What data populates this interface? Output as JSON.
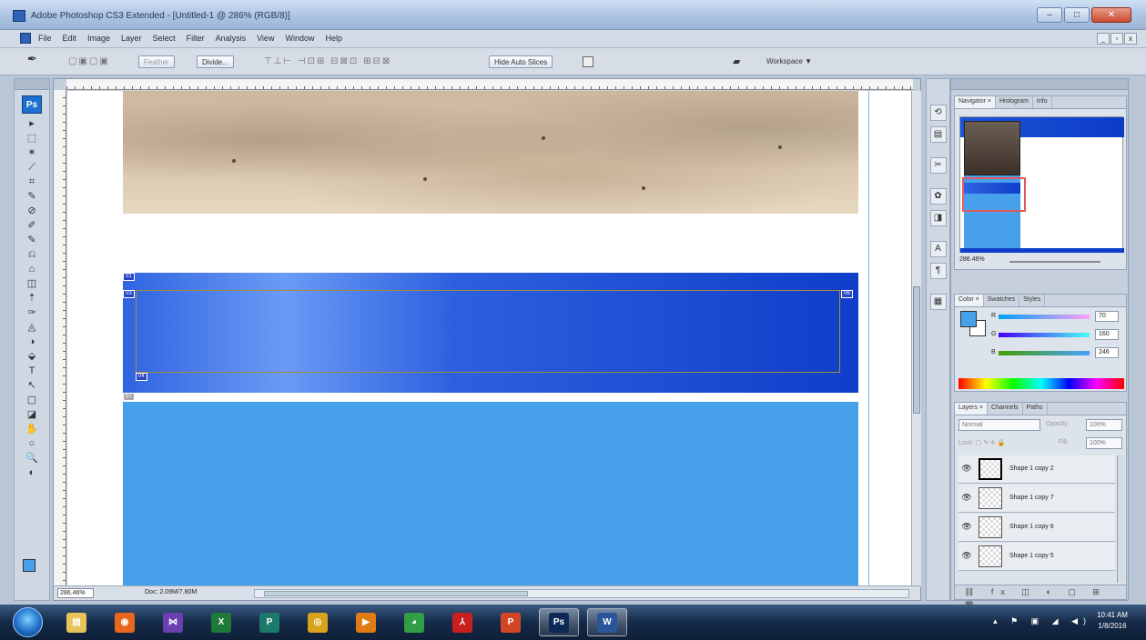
{
  "window": {
    "title": "Adobe Photoshop CS3 Extended - [Untitled-1 @ 286% (RGB/8)]",
    "buttons": {
      "minimize": "–",
      "maximize": "□",
      "close": "✕"
    }
  },
  "menu": {
    "items": [
      "File",
      "Edit",
      "Image",
      "Layer",
      "Select",
      "Filter",
      "Analysis",
      "View",
      "Window",
      "Help"
    ],
    "doc_buttons": [
      "_",
      "▫",
      "x"
    ]
  },
  "options_bar": {
    "tool_glyph": "✒",
    "path_icons": "▢▣▢▣",
    "feather_btn": "Feather",
    "divide_btn": "Divide...",
    "align_icons": "⊤⊥⊢ ⊣⊡⊞ ⊟⊠⊡ ⊞⊟⊠",
    "hide_auto_slices": "Hide Auto Slices",
    "workspace": "Workspace ▼"
  },
  "tools": {
    "logo": "Ps",
    "icons": [
      "▸",
      "⬚",
      "✶",
      "⟋",
      "⌗",
      "✎",
      "⊘",
      "✐",
      "✎",
      "⎌",
      "⌂",
      "◫",
      "⇡",
      "✑",
      "◬",
      "◑",
      "⬙",
      "T",
      "↖",
      "▢",
      "◪",
      "✋",
      "○",
      "🔍",
      "◐"
    ]
  },
  "document": {
    "zoom": "286.46%",
    "doc_size": "Doc: 2.09M/7.80M",
    "slice_tags": [
      "01",
      "03",
      "04",
      "06",
      "07"
    ]
  },
  "navigator": {
    "tabs": [
      "Navigator ×",
      "Histogram",
      "Info"
    ],
    "zoom": "286.46%"
  },
  "color": {
    "tabs": [
      "Color ×",
      "Swatches",
      "Styles"
    ],
    "fg_hex": "#46a0ea",
    "r_label": "R",
    "r": "70",
    "g_label": "G",
    "g": "160",
    "b_label": "B",
    "b": "246"
  },
  "layers": {
    "tabs": [
      "Layers ×",
      "Channels",
      "Paths"
    ],
    "blend_mode": "Normal",
    "opacity_label": "Opacity:",
    "opacity": "100%",
    "lock_label": "Lock: ▢ ✎ ✛ 🔒",
    "fill_label": "Fill:",
    "fill": "100%",
    "items": [
      {
        "name": "Shape 1 copy 2",
        "visible": "👁"
      },
      {
        "name": "Shape 1 copy 7",
        "visible": "👁"
      },
      {
        "name": "Shape 1 copy 6",
        "visible": "👁"
      },
      {
        "name": "Shape 1 copy 5",
        "visible": "👁"
      }
    ],
    "footer_icons": "⛓ fx ◫ ◐ ▢ ⊞ 🗑"
  },
  "taskbar": {
    "apps": [
      "explorer",
      "firefox",
      "visual-studio",
      "excel",
      "publisher",
      "acrobat-reader",
      "media",
      "chrome",
      "pdf",
      "powerpoint",
      "photoshop",
      "word"
    ],
    "tray_icons": "▴ ⚑ ▣ ◢ ◀)",
    "time": "10:41 AM",
    "date": "1/8/2016"
  }
}
